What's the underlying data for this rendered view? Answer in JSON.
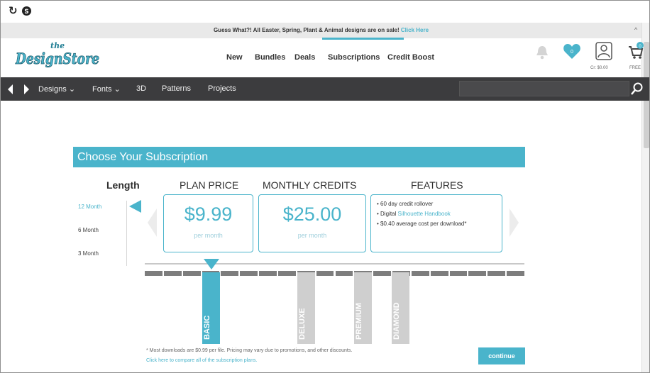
{
  "browser": {
    "refresh_icon": "refresh-icon",
    "extension_icon": "extension-icon"
  },
  "announcement": {
    "text": "Guess What?! All Easter, Spring, Plant & Animal designs are on sale!",
    "link": "Click Here"
  },
  "header": {
    "logo_top": "the",
    "logo_main": "DesignStore",
    "nav": [
      "New",
      "Bundles",
      "Deals",
      "Subscriptions",
      "Credit Boost"
    ],
    "heart_count": "0",
    "credit_label": "Cr: $0.00",
    "cart_count": "0",
    "cart_label": "FREE"
  },
  "dark_nav": {
    "items": [
      "Designs",
      "Fonts",
      "3D",
      "Patterns",
      "Projects"
    ],
    "search_placeholder": ""
  },
  "subscription": {
    "title": "Choose Your Subscription",
    "length_heading": "Length",
    "lengths": [
      "12 Month",
      "6 Month",
      "3 Month"
    ],
    "selected_length": "12 Month",
    "price_heading": "PLAN PRICE",
    "price_value": "$9.99",
    "price_caption": "per month",
    "credits_heading": "MONTHLY CREDITS",
    "credits_value": "$25.00",
    "credits_caption": "per month",
    "features_heading": "FEATURES",
    "features": [
      {
        "pre": "60 day credit rollover",
        "hl": "",
        "post": ""
      },
      {
        "pre": "Digital ",
        "hl": "Silhouette Handbook",
        "post": ""
      },
      {
        "pre": "$0.40 average cost per download*",
        "hl": "",
        "post": ""
      }
    ],
    "plans": [
      "BASIC",
      "DELUXE",
      "PREMIUM",
      "DIAMOND"
    ],
    "selected_plan": "BASIC",
    "footnote": "* Most downloads are $0.99 per file. Pricing may vary due to promotions, and other discounts.",
    "compare_link": "Click here to compare all of the subscription plans.",
    "continue_label": "continue"
  },
  "colors": {
    "accent": "#4ab4cb",
    "dark_nav": "#3c3c3e",
    "inactive_tab": "#cfcfcf"
  }
}
